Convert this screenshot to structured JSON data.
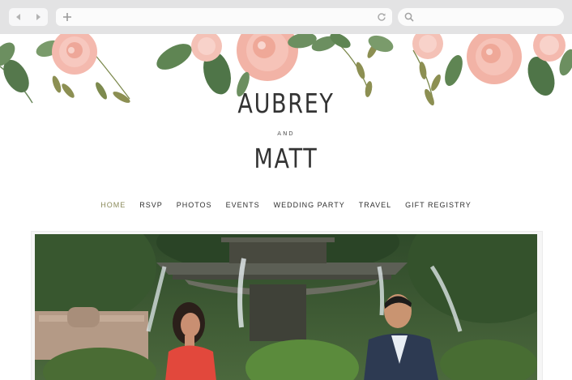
{
  "browser": {
    "back_icon": "back-arrow-icon",
    "forward_icon": "forward-arrow-icon",
    "new_tab_icon": "plus-icon",
    "reload_icon": "reload-icon",
    "search_icon": "search-icon"
  },
  "couple": {
    "name1": "AUBREY",
    "and": "AND",
    "name2": "MATT"
  },
  "nav": {
    "items": [
      {
        "label": "HOME",
        "active": true
      },
      {
        "label": "RSVP"
      },
      {
        "label": "PHOTOS"
      },
      {
        "label": "EVENTS"
      },
      {
        "label": "WEDDING PARTY"
      },
      {
        "label": "TRAVEL"
      },
      {
        "label": "GIFT REGISTRY"
      }
    ]
  },
  "colors": {
    "nav_active": "#8a8a5a",
    "text_dark": "#333333",
    "rose": "#f2b3a6",
    "leaf": "#5b7d52"
  }
}
